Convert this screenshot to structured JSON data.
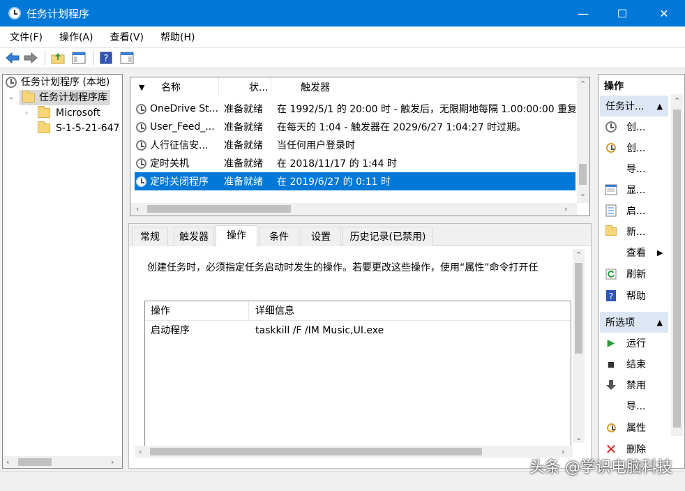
{
  "window": {
    "title": "任务计划程序",
    "minimize_glyph": "—",
    "maximize_glyph": "☐",
    "close_glyph": "✕"
  },
  "menu": [
    "文件(F)",
    "操作(A)",
    "查看(V)",
    "帮助(H)"
  ],
  "tree": {
    "root": "任务计划程序 (本地)",
    "library": "任务计划程序库",
    "children": [
      "Microsoft",
      "S-1-5-21-647"
    ]
  },
  "task_list": {
    "columns": [
      "名称",
      "状...",
      "触发器"
    ],
    "rows": [
      {
        "name": "OneDrive St...",
        "status": "准备就绪",
        "trigger": "在 1992/5/1 的 20:00 时 - 触发后，无限期地每隔 1.00:00:00 重复"
      },
      {
        "name": "User_Feed_...",
        "status": "准备就绪",
        "trigger": "在每天的 1:04 - 触发器在 2029/6/27 1:04:27 时过期。"
      },
      {
        "name": "人行征信安...",
        "status": "准备就绪",
        "trigger": "当任何用户登录时"
      },
      {
        "name": "定时关机",
        "status": "准备就绪",
        "trigger": "在 2018/11/17 的 1:44 时"
      },
      {
        "name": "定时关闭程序",
        "status": "准备就绪",
        "trigger": "在 2019/6/27 的 0:11 时"
      }
    ],
    "selected_index": 4
  },
  "details": {
    "tabs": [
      "常规",
      "触发器",
      "操作",
      "条件",
      "设置",
      "历史记录(已禁用)"
    ],
    "active_tab": 2,
    "description": "创建任务时，必须指定任务启动时发生的操作。若要更改这些操作，使用“属性”命令打开任",
    "action_columns": [
      "操作",
      "详细信息"
    ],
    "action_rows": [
      {
        "action": "启动程序",
        "detail": "taskkill /F /IM Music,UI.exe"
      }
    ]
  },
  "actions_pane": {
    "title": "操作",
    "section1": {
      "header": "任务计...",
      "items": [
        {
          "label": "创...",
          "icon": "create-basic-task-icon"
        },
        {
          "label": "创...",
          "icon": "create-task-icon"
        },
        {
          "label": "导...",
          "icon": "none"
        },
        {
          "label": "显...",
          "icon": "display-running-tasks-icon"
        },
        {
          "label": "启...",
          "icon": "enable-history-icon"
        },
        {
          "label": "新...",
          "icon": "new-folder-icon"
        },
        {
          "label": "查看",
          "icon": "none"
        },
        {
          "label": "刷新",
          "icon": "refresh-icon"
        },
        {
          "label": "帮助",
          "icon": "help-icon"
        }
      ]
    },
    "section2": {
      "header": "所选项",
      "items": [
        {
          "label": "运行",
          "icon": "run-icon"
        },
        {
          "label": "结束",
          "icon": "end-icon"
        },
        {
          "label": "禁用",
          "icon": "disable-icon"
        },
        {
          "label": "导...",
          "icon": "none"
        },
        {
          "label": "属性",
          "icon": "properties-icon"
        },
        {
          "label": "删除",
          "icon": "delete-icon"
        }
      ]
    }
  },
  "watermark": "头条 @学识电脑科技",
  "colors": {
    "accent": "#0078d7",
    "selection": "#0078d7",
    "section_header": "#dce6f4"
  }
}
